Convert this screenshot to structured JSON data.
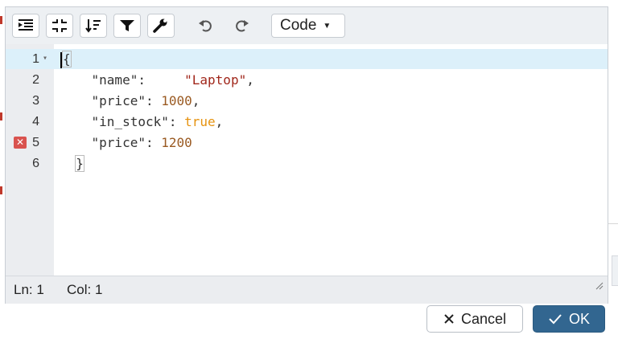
{
  "toolbar": {
    "buttons": [
      {
        "name": "indent-icon"
      },
      {
        "name": "collapse-icon"
      },
      {
        "name": "sort-icon"
      },
      {
        "name": "filter-icon"
      },
      {
        "name": "wrench-icon"
      },
      {
        "name": "undo-icon"
      },
      {
        "name": "redo-icon"
      }
    ],
    "mode_label": "Code",
    "mode_caret": "▼"
  },
  "editor": {
    "lines": [
      {
        "number": "1",
        "fold": "▾",
        "error": false
      },
      {
        "number": "2",
        "fold": "",
        "error": false
      },
      {
        "number": "3",
        "fold": "",
        "error": false
      },
      {
        "number": "4",
        "fold": "",
        "error": false
      },
      {
        "number": "5",
        "fold": "",
        "error": true
      },
      {
        "number": "6",
        "fold": "",
        "error": false
      }
    ],
    "error_glyph": "✕",
    "code": {
      "l1_open": "{",
      "l2_key": "\"name\"",
      "l2_colon": ":",
      "l2_value": "\"Laptop\"",
      "l2_comma": ",",
      "l3_key": "\"price\"",
      "l3_colon": ": ",
      "l3_value": "1000",
      "l3_comma": ",",
      "l4_key": "\"in_stock\"",
      "l4_colon": ": ",
      "l4_value": "true",
      "l4_comma": ",",
      "l5_key": "\"price\"",
      "l5_colon": ": ",
      "l5_value": "1200",
      "l6_close": "}"
    }
  },
  "status": {
    "line": "Ln: 1",
    "column": "Col: 1"
  },
  "footer": {
    "cancel_label": "Cancel",
    "ok_label": "OK"
  },
  "colors": {
    "accent": "#326690",
    "error": "#d9534f",
    "active_line": "#dcf0fa"
  }
}
